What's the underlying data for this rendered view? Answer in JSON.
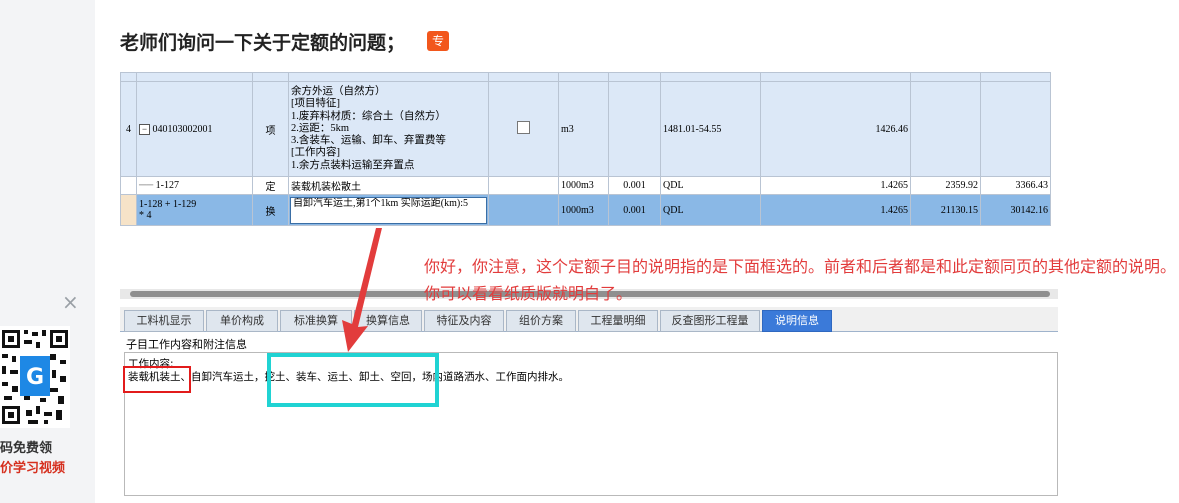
{
  "sidebar_ad": {
    "close": "×",
    "line1": "码免费领",
    "line2": "价学习视频"
  },
  "post": {
    "title": "老师们询问一下关于定额的问题；",
    "badge": "专"
  },
  "grid": {
    "top_row_partial": "",
    "main_row": {
      "index": "4",
      "expand": "−",
      "code": "040103002001",
      "category": "项",
      "desc_lines": [
        "余方外运（自然方）",
        "[项目特征]",
        "1.废弃料材质：综合土（自然方）",
        "2.运距：5km",
        "3.含装车、运输、卸车、弃置费等",
        "[工作内容]",
        "1.余方点装料运输至弃置点"
      ],
      "unit": "m3",
      "qty_expr": "1481.01-54.55",
      "qty": "1426.46"
    },
    "sub_rows": [
      {
        "code": "1-127",
        "category": "定",
        "desc": "装载机装松散土",
        "unit": "1000m3",
        "ratio": "0.001",
        "qty_expr": "QDL",
        "qty": "1.4265",
        "price": "2359.92",
        "total": "3366.43"
      },
      {
        "code_line1": "1-128 + 1-129",
        "code_line2": "* 4",
        "category": "换",
        "desc": "自卸汽车运土,第1个1km  实际运距(km):5",
        "unit": "1000m3",
        "ratio": "0.001",
        "qty_expr": "QDL",
        "qty": "1.4265",
        "price": "21130.15",
        "total": "30142.16"
      }
    ]
  },
  "tabs": [
    {
      "label": "工料机显示",
      "active": false
    },
    {
      "label": "单价构成",
      "active": false
    },
    {
      "label": "标准换算",
      "active": false
    },
    {
      "label": "换算信息",
      "active": false
    },
    {
      "label": "特征及内容",
      "active": false
    },
    {
      "label": "组价方案",
      "active": false
    },
    {
      "label": "工程量明细",
      "active": false
    },
    {
      "label": "反查图形工程量",
      "active": false
    },
    {
      "label": "说明信息",
      "active": true
    }
  ],
  "info_panel": {
    "subtitle": "子目工作内容和附注信息",
    "work_label": "工作内容:",
    "work_text": "装载机装土、自卸汽车运土，挖土、装车、运土、卸土、空回，场内道路洒水、工作面内排水。"
  },
  "annotation": "你好，你注意，这个定额子目的说明指的是下面框选的。前者和后者都是和此定额同页的其他定额的说明。你可以看看纸质版就明白了。",
  "colors": {
    "accent_red": "#e23c3c",
    "highlight_cyan": "#20d3d3",
    "selected_row": "#8ab8e6",
    "active_tab": "#3b7ad9"
  }
}
